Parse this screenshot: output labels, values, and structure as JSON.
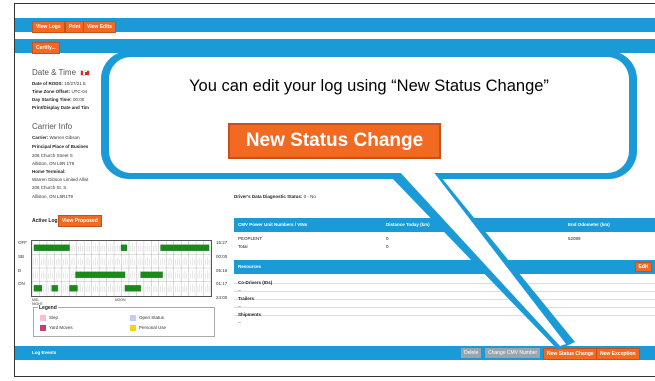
{
  "toolbar": {
    "view_logs": "View Logs",
    "print": "Print",
    "view_edits": "View Edits",
    "certify": "Certify..."
  },
  "datetime": {
    "heading": "Date & Time",
    "date_label": "Date of RODS:",
    "date_value": "10/27/21 E",
    "tz_label": "Time Zone Offset:",
    "tz_value": "UTC-04",
    "start_label": "Day Starting Time:",
    "start_value": "00:00",
    "print_label": "Print/Display Date and Tim"
  },
  "carrier": {
    "heading": "Carrier Info",
    "carrier_label": "Carrier:",
    "carrier_value": "Warren Gibson",
    "ppb_label": "Principal Place of Busines",
    "ppb_addr1": "206 Church Street S",
    "ppb_addr2": "Alliston, ON L9R 1T9",
    "home_label": "Home Terminal:",
    "home_name": "Warren Gibson Limited Allist",
    "home_addr1": "206 Church St. S.",
    "home_addr2": "Alliston, ON L9R1T9"
  },
  "diag": {
    "label": "Driver's Data Diagnostic Status:",
    "value": "0 - No"
  },
  "active_log": {
    "label": "Active Log",
    "view_proposed": "View Proposed"
  },
  "graph": {
    "rows": [
      "OFF",
      "SB",
      "D",
      "ON"
    ],
    "totals": [
      "15:27",
      "00:00",
      "05:16",
      "01:17"
    ],
    "grand_total": "24:00",
    "left_foot": "MID-NIGHT",
    "mid_foot": "NOON"
  },
  "cmv_table": {
    "headers": [
      "CMV Power Unit Numbers / VINs",
      "Distance Today (km)",
      "End Odometer (km)"
    ],
    "row": [
      "PEOPLENT",
      "0",
      "52089"
    ],
    "total_label": "Total",
    "total_value": "0"
  },
  "resources": {
    "heading": "Resources",
    "edit": "Edit",
    "codrivers": "Co-Drivers (IDs)",
    "codrivers_value": "--",
    "trailers": "Trailers",
    "trailers_value": "--",
    "shipments": "Shipments",
    "shipments_value": "--"
  },
  "legend": {
    "title": "Legend",
    "items": [
      {
        "label": "Slep",
        "color": "#f5c0c8"
      },
      {
        "label": "Open Status",
        "color": "#c8c8f5"
      },
      {
        "label": "Yard Moves",
        "color": "#c2406e"
      },
      {
        "label": "Personal Use",
        "color": "#f5d020"
      }
    ]
  },
  "log_events": {
    "label": "Log Events",
    "delete": "Delete",
    "change_cmv": "Change CMV Number",
    "new_status": "New Status Change",
    "new_exception": "New Exception"
  },
  "callout": {
    "text": "You can edit your log using “New Status Change”",
    "button": "New Status Change"
  },
  "colors": {
    "accent": "#1a9bd7",
    "button": "#f26a21",
    "duty": "#1a8a1a"
  }
}
